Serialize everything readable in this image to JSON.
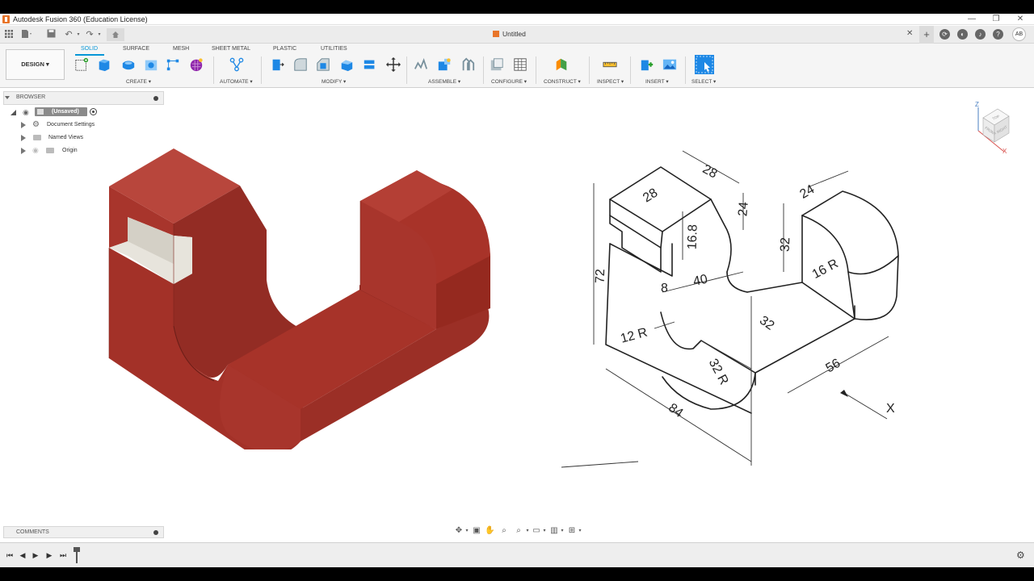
{
  "window": {
    "title": "Autodesk Fusion 360 (Education License)",
    "controls": [
      "—",
      "❐",
      "✕"
    ]
  },
  "quick_access": {
    "document_title": "Untitled",
    "avatar_initials": "AB",
    "new_tab": "+",
    "close_tab": "✕"
  },
  "ribbon": {
    "workspace_label": "DESIGN ▾",
    "tabs": [
      "SOLID",
      "SURFACE",
      "MESH",
      "SHEET METAL",
      "PLASTIC",
      "UTILITIES"
    ],
    "active_tab": "SOLID",
    "groups": [
      "CREATE ▾",
      "AUTOMATE ▾",
      "MODIFY ▾",
      "ASSEMBLE ▾",
      "CONFIGURE ▾",
      "CONSTRUCT ▾",
      "INSPECT ▾",
      "INSERT ▾",
      "SELECT ▾"
    ],
    "accent_color": "#0696d7"
  },
  "browser": {
    "header": "BROWSER",
    "root_label": "(Unsaved)",
    "items": [
      "Document Settings",
      "Named Views",
      "Origin"
    ]
  },
  "comments": {
    "header": "COMMENTS"
  },
  "model": {
    "body_color": "#a8352c",
    "icons": [
      "bracket-3d-model",
      "isometric-drawing"
    ]
  },
  "drawing": {
    "dimensions": [
      "28",
      "28",
      "24",
      "24",
      "16.8",
      "32",
      "72",
      "40",
      "8",
      "16 R",
      "12 R",
      "32",
      "32 R",
      "56",
      "84"
    ],
    "view_arrow_label": "X"
  },
  "viewcube": {
    "faces": [
      "TOP",
      "FRONT",
      "RIGHT"
    ],
    "axes": [
      "Z",
      "X"
    ]
  }
}
